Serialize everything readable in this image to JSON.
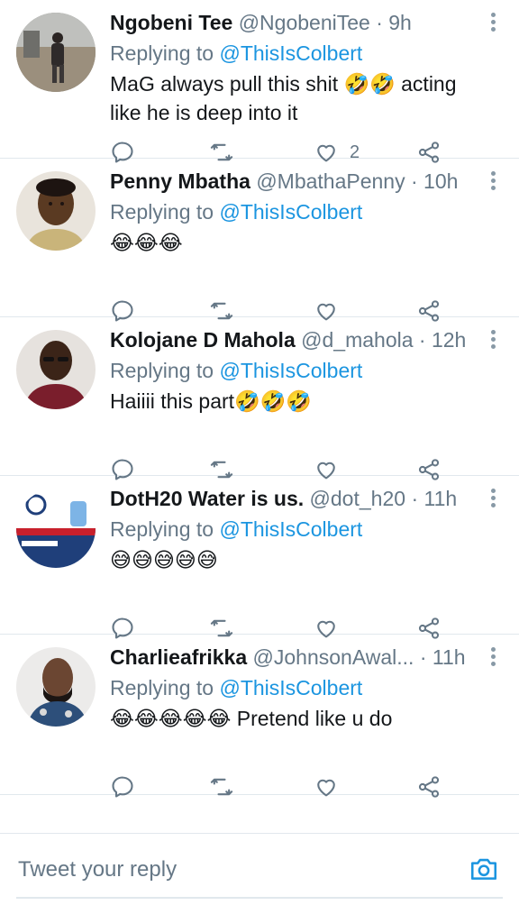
{
  "tweets": [
    {
      "name": "Ngobeni Tee",
      "handle": "@NgobeniTee",
      "separator": "·",
      "time": "9h",
      "replying_label": "Replying to",
      "replying_to": "@ThisIsColbert",
      "text_line1": "MaG always pull this shit 🤣🤣 acting",
      "text_line2": "like he is deep into it",
      "like_count": "2"
    },
    {
      "name": "Penny Mbatha",
      "handle": "@MbathaPenny",
      "separator": "·",
      "time": "10h",
      "replying_label": "Replying to",
      "replying_to": "@ThisIsColbert",
      "text_line1": "😂😂😂",
      "text_line2": "",
      "like_count": ""
    },
    {
      "name": "Kolojane D Mahola",
      "handle": "@d_mahola",
      "separator": "·",
      "time": "12h",
      "replying_label": "Replying to",
      "replying_to": "@ThisIsColbert",
      "text_line1": "Haiiii this part🤣🤣🤣",
      "text_line2": "",
      "like_count": ""
    },
    {
      "name": "DotH20 Water is us.",
      "handle": "@dot_h20",
      "separator": "·",
      "time": "11h",
      "replying_label": "Replying to",
      "replying_to": "@ThisIsColbert",
      "text_line1": "😅😅😅😅😅",
      "text_line2": "",
      "like_count": ""
    },
    {
      "name": "Charlieafrikka",
      "handle": "@JohnsonAwal...",
      "separator": "·",
      "time": "11h",
      "replying_label": "Replying to",
      "replying_to": "@ThisIsColbert",
      "text_line1": "😂😂😂😂😂 Pretend like u do",
      "text_line2": "",
      "like_count": ""
    }
  ],
  "reply_bar": {
    "placeholder": "Tweet your reply"
  },
  "colors": {
    "accent": "#1b95e0",
    "muted": "#657786",
    "divider": "#e1e8ed"
  },
  "icons": {
    "reply": "reply-icon",
    "retweet": "retweet-icon",
    "like": "heart-icon",
    "share": "share-icon",
    "more": "more-vertical-icon",
    "camera": "camera-icon"
  }
}
